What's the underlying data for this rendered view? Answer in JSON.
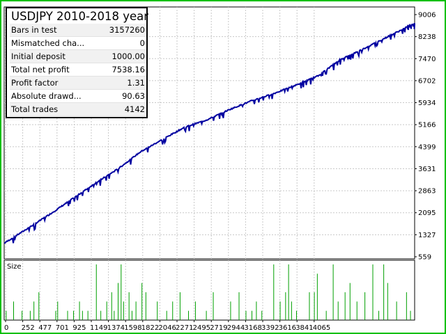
{
  "stats": {
    "title": "USDJPY 2010-2018 year",
    "rows": [
      {
        "label": "Bars in test",
        "value": "3157260"
      },
      {
        "label": "Mismatched cha...",
        "value": "0"
      },
      {
        "label": "Initial deposit",
        "value": "1000.00"
      },
      {
        "label": "Total net profit",
        "value": "7538.16"
      },
      {
        "label": "Profit factor",
        "value": "1.31"
      },
      {
        "label": "Absolute drawd...",
        "value": "90.63"
      },
      {
        "label": "Total trades",
        "value": "4142"
      }
    ]
  },
  "lower_panel": {
    "label": "Size"
  },
  "colors": {
    "frame": "#00c000",
    "balance_line": "#0000a0",
    "size_bars": "#00a000",
    "grid": "#c8c8c8"
  },
  "chart_data": [
    {
      "type": "line",
      "title": "",
      "x_ticks": [
        "0",
        "252",
        "477",
        "701",
        "925",
        "1149",
        "1374",
        "1598",
        "1822",
        "2046",
        "2271",
        "2495",
        "2719",
        "2944",
        "3168",
        "3392",
        "3616",
        "3841",
        "4065"
      ],
      "y_ticks": [
        "9006",
        "8238",
        "7470",
        "6702",
        "5934",
        "5166",
        "4399",
        "3631",
        "2863",
        "2095",
        "1327",
        "559"
      ],
      "xlim": [
        0,
        4142
      ],
      "ylim": [
        559,
        9006
      ],
      "series": [
        {
          "x": [
            0,
            252,
            477,
            701,
            925,
            1149,
            1374,
            1598,
            1822,
            2046,
            2271,
            2495,
            2719,
            2944,
            3168,
            3392,
            3616,
            3841,
            4065,
            4142
          ],
          "y": [
            1000,
            1540,
            2030,
            2550,
            3070,
            3550,
            4130,
            4560,
            4980,
            5230,
            5580,
            5880,
            6130,
            6420,
            6740,
            7300,
            7650,
            8030,
            8410,
            8540
          ]
        }
      ]
    },
    {
      "type": "bar",
      "title": "",
      "series": [
        {
          "name": "Size",
          "x": [
            20,
            95,
            180,
            263,
            300,
            350,
            520,
            540,
            640,
            700,
            760,
            790,
            845,
            930,
            975,
            1035,
            1085,
            1110,
            1150,
            1180,
            1205,
            1260,
            1290,
            1330,
            1390,
            1430,
            1545,
            1640,
            1700,
            1775,
            1860,
            1930,
            2040,
            2110,
            2285,
            2370,
            2440,
            2500,
            2545,
            2600,
            2720,
            2785,
            2840,
            2870,
            2900,
            2950,
            3080,
            3130,
            3160,
            3250,
            3320,
            3370,
            3440,
            3490,
            3560,
            3640,
            3720,
            3780,
            3830,
            3870,
            3960,
            4060,
            4100
          ],
          "values": [
            1,
            2,
            1,
            1,
            2,
            3,
            1,
            2,
            1,
            1,
            2,
            1,
            1,
            6,
            1,
            2,
            3,
            1,
            4,
            6,
            2,
            3,
            1,
            2,
            4,
            3,
            2,
            1,
            2,
            3,
            1,
            2,
            1,
            3,
            2,
            3,
            1,
            1,
            2,
            1,
            6,
            2,
            3,
            6,
            2,
            1,
            3,
            3,
            5,
            1,
            6,
            2,
            3,
            4,
            2,
            3,
            6,
            1,
            6,
            4,
            2,
            3,
            1
          ],
          "ylim": [
            0,
            6
          ]
        }
      ]
    }
  ]
}
